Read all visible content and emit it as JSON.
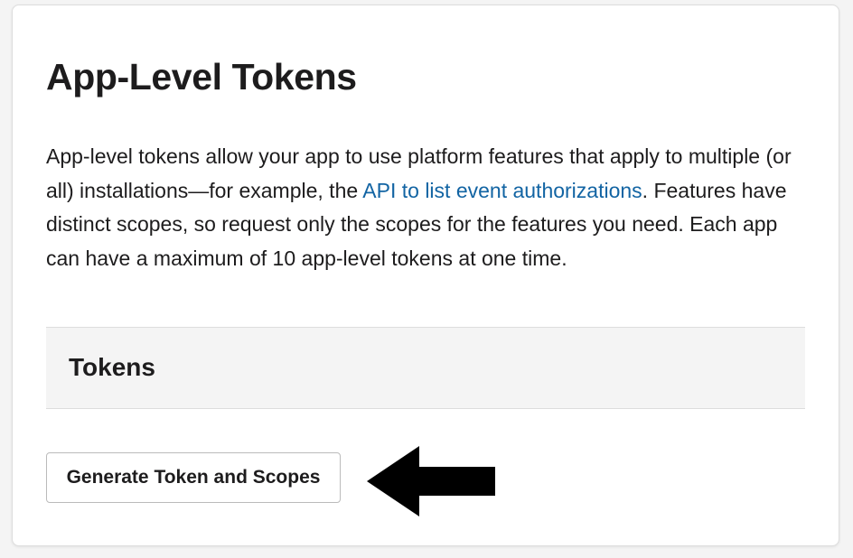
{
  "header": {
    "title": "App-Level Tokens"
  },
  "description": {
    "text_before_link": "App-level tokens allow your app to use platform features that apply to multiple (or all) installations—for example, the ",
    "link_label": "API to list event authorizations",
    "text_after_link": ". Features have distinct scopes, so request only the scopes for the features you need. Each app can have a maximum of 10 app-level tokens at one time."
  },
  "tokens": {
    "heading": "Tokens",
    "generate_button_label": "Generate Token and Scopes"
  },
  "annotation": {
    "arrow_icon": "left-arrow-icon",
    "arrow_color": "#000000"
  },
  "colors": {
    "link": "#1264a3",
    "text": "#1d1c1d",
    "section_background": "#f4f4f4"
  }
}
